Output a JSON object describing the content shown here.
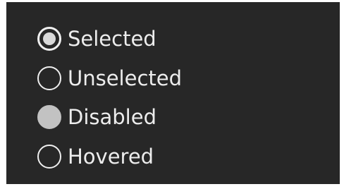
{
  "radio_group": {
    "options": [
      {
        "label": "Selected",
        "state": "selected"
      },
      {
        "label": "Unselected",
        "state": "unselected"
      },
      {
        "label": "Disabled",
        "state": "disabled"
      },
      {
        "label": "Hovered",
        "state": "hovered"
      }
    ]
  },
  "colors": {
    "panel_background": "#272727",
    "text": "#ededed",
    "radio_border": "#efefef",
    "selected_dot": "#d9d9d9",
    "disabled_fill": "#c2c2c2"
  }
}
